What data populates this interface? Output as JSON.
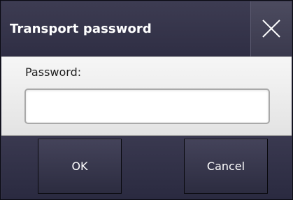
{
  "dialog": {
    "title": "Transport password",
    "close_icon": "close-icon"
  },
  "form": {
    "password_label": "Password:",
    "password_value": "",
    "password_placeholder": ""
  },
  "buttons": {
    "ok_label": "OK",
    "cancel_label": "Cancel"
  },
  "colors": {
    "titlebar": "#353448",
    "content_bg": "#f0f0f0",
    "button_bg": "#3a3950",
    "text_light": "#ffffff"
  }
}
